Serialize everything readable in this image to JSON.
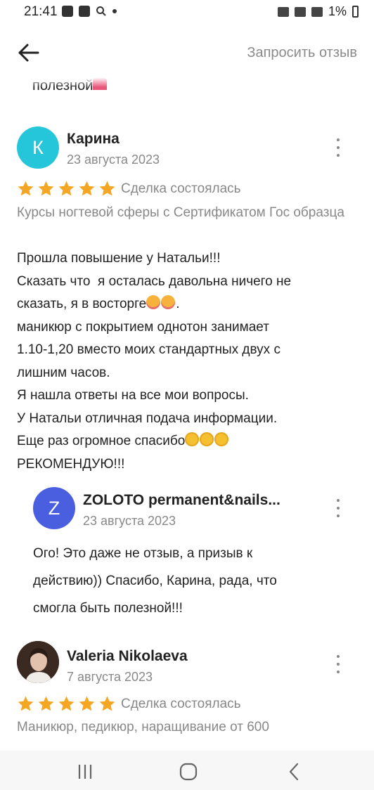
{
  "status_bar": {
    "time": "21:41",
    "battery": "1%"
  },
  "header": {
    "request_review": "Запросить отзыв"
  },
  "previous_review_tail": {
    "text": "полезной"
  },
  "reviews": [
    {
      "avatar_letter": "К",
      "avatar_color": "#26c6da",
      "name": "Карина",
      "date": "23 августа 2023",
      "rating": 5,
      "deal_status": "Сделка состоялась",
      "service": "Курсы ногтевой сферы с Сертификатом Гос образца",
      "text_lines": [
        "Прошла повышение у Натальи!!!",
        "Сказать что  я осталась давольна ничего не",
        "сказать, я в восторге",
        "маникюр с покрытием однотон занимает",
        "1.10-1,20 вместо моих стандартных двух с",
        "лишним часов.",
        "Я нашла ответы на все мои вопросы.",
        "У Натальи отличная подача информации.",
        "Еще раз огромное спасибо",
        "РЕКОМЕНДУЮ!!!"
      ],
      "reply": {
        "avatar_letter": "Z",
        "avatar_color": "#4a5fe0",
        "name": "ZOLOTO permanent&nails...",
        "date": "23 августа 2023",
        "text_lines": [
          "Ого! Это даже не отзыв, а призыв к",
          "действию)) Спасибо, Карина, рада, что",
          "смогла быть полезной!!!"
        ]
      }
    },
    {
      "name": "Valeria Nikolaeva",
      "date": "7 августа 2023",
      "rating": 5,
      "deal_status": "Сделка состоялась",
      "service": "Маникюр, педикюр, наращивание от 600"
    }
  ],
  "colors": {
    "star": "#f5a623",
    "muted": "#888888",
    "accent_cyan": "#26c6da",
    "accent_blue": "#4a5fe0"
  }
}
